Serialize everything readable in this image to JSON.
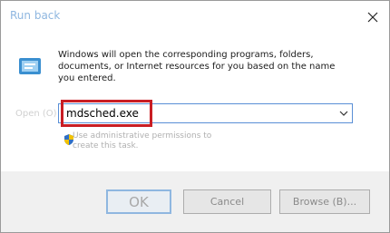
{
  "window": {
    "title": "Run back"
  },
  "description": "Windows will open the corresponding programs, folders, documents, or Internet resources for you based on the name you entered.",
  "open_label": "Open (O)",
  "command": {
    "value": "mdsched.exe"
  },
  "admin_note": "Use administrative permissions to create this task.",
  "buttons": {
    "ok": "OK",
    "cancel": "Cancel",
    "browse": "Browse (B)..."
  },
  "colors": {
    "highlight": "#c91e24",
    "accent": "#5a8fd6"
  }
}
